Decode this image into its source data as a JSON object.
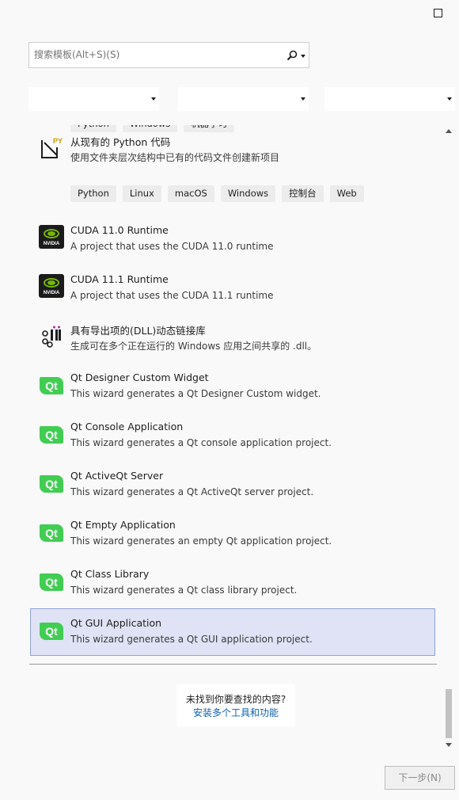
{
  "search": {
    "placeholder": "搜索模板(Alt+S)(S)"
  },
  "filters": [
    {
      "value": ""
    },
    {
      "value": ""
    },
    {
      "value": ""
    }
  ],
  "prev_tags": [
    "Python",
    "Windows",
    "机器学习"
  ],
  "items": [
    {
      "title": "从现有的 Python 代码",
      "desc": "使用文件夹层次结构中已有的代码文件创建新项目",
      "icon": "python-existing-code-icon",
      "tags": [
        "Python",
        "Linux",
        "macOS",
        "Windows",
        "控制台",
        "Web"
      ]
    },
    {
      "title": "CUDA 11.0 Runtime",
      "desc": "A project that uses the CUDA 11.0 runtime",
      "icon": "nvidia-icon"
    },
    {
      "title": "CUDA 11.1 Runtime",
      "desc": "A project that uses the CUDA 11.1 runtime",
      "icon": "nvidia-icon"
    },
    {
      "title": "具有导出项的(DLL)动态链接库",
      "desc": "生成可在多个正在运行的 Windows 应用之间共享的 .dll。",
      "icon": "dll-icon"
    },
    {
      "title": "Qt Designer Custom Widget",
      "desc": "This wizard generates a Qt Designer Custom widget.",
      "icon": "qt-icon"
    },
    {
      "title": "Qt Console Application",
      "desc": "This wizard generates a Qt console application project.",
      "icon": "qt-icon"
    },
    {
      "title": "Qt ActiveQt Server",
      "desc": "This wizard generates a Qt ActiveQt server project.",
      "icon": "qt-icon"
    },
    {
      "title": "Qt Empty Application",
      "desc": "This wizard generates an empty Qt application project.",
      "icon": "qt-icon"
    },
    {
      "title": "Qt Class Library",
      "desc": "This wizard generates a Qt class library project.",
      "icon": "qt-icon"
    },
    {
      "title": "Qt GUI Application",
      "desc": "This wizard generates a Qt GUI application project.",
      "icon": "qt-icon"
    }
  ],
  "qt_label": "Qt",
  "nvidia_label": "NVIDIA",
  "python_badge": "PY",
  "help": {
    "question": "未找到你要查找的内容?",
    "link": "安装多个工具和功能"
  },
  "next_button": "下一步(N)",
  "colors": {
    "qt_green": "#41cd52",
    "nvidia_green": "#76b900",
    "selected_bg": "#dfe3f5",
    "link": "#0e60ae"
  }
}
